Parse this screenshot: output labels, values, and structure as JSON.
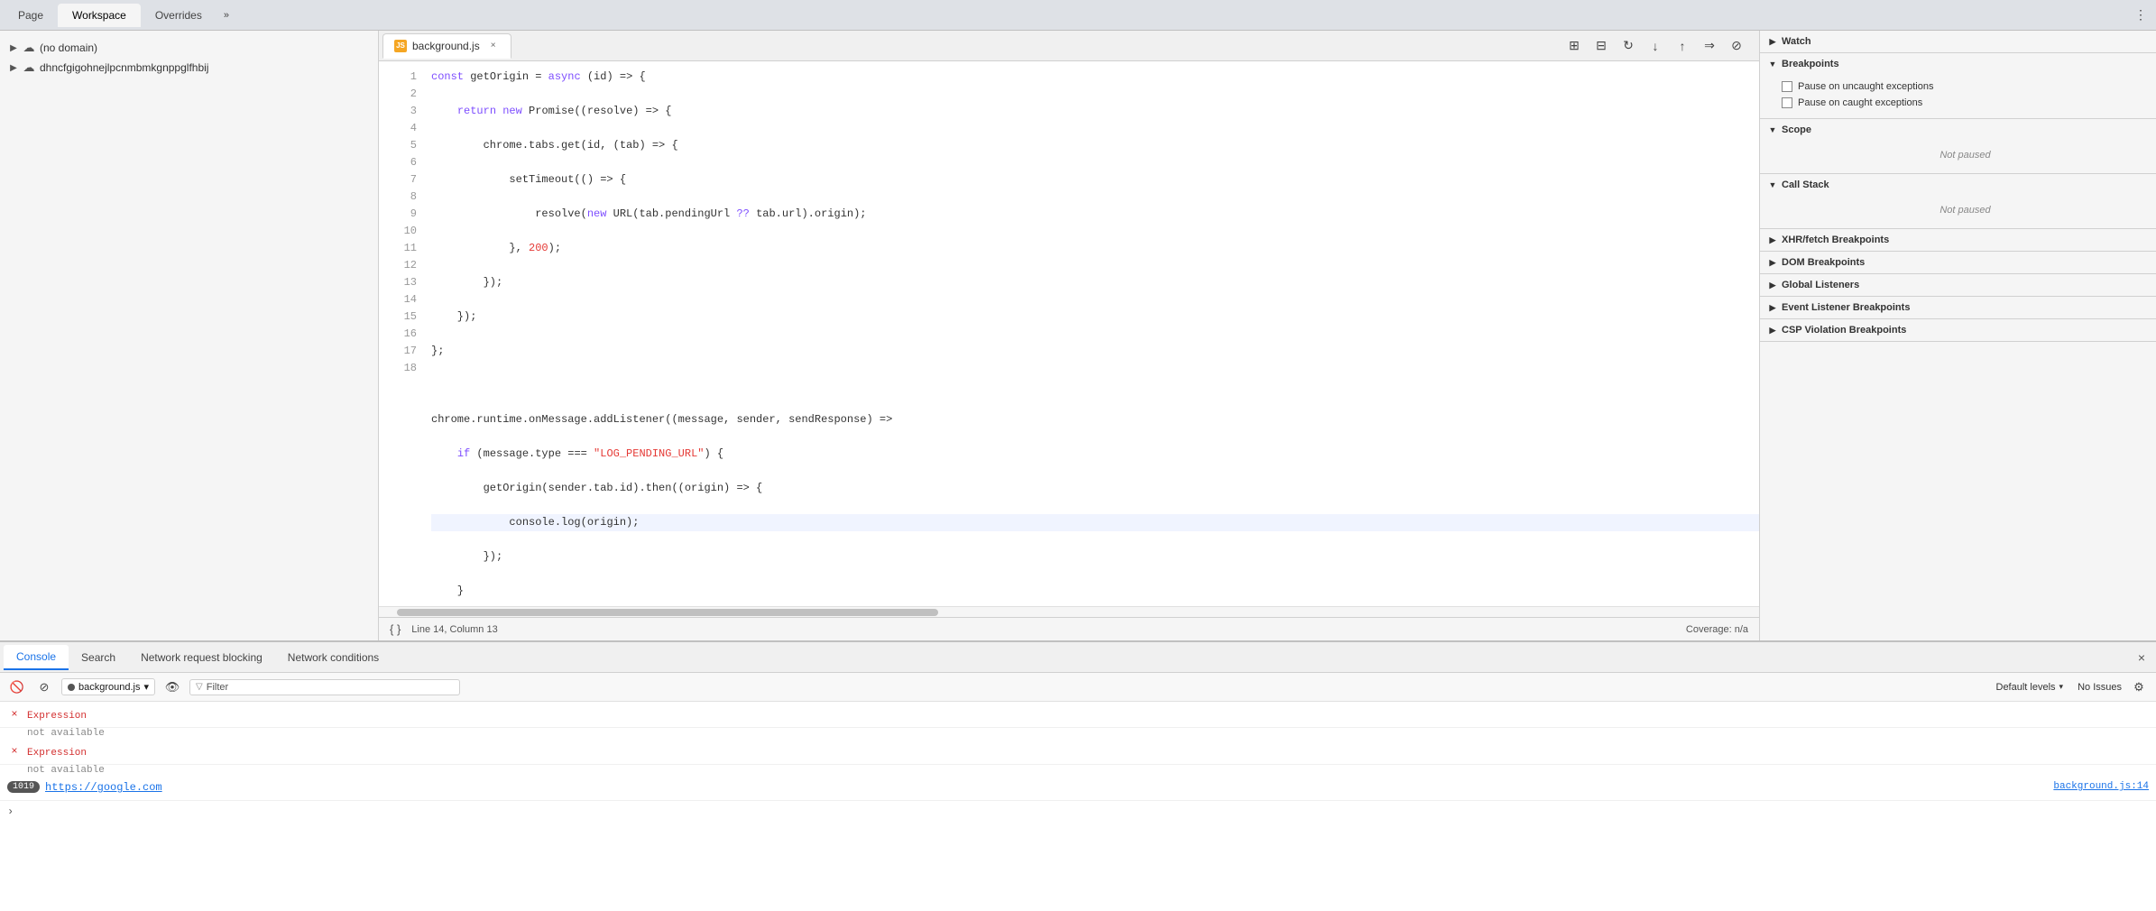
{
  "topTabs": {
    "items": [
      {
        "label": "Page",
        "active": false
      },
      {
        "label": "Workspace",
        "active": true
      },
      {
        "label": "Overrides",
        "active": false
      }
    ],
    "moreIcon": "»"
  },
  "fileTree": {
    "items": [
      {
        "label": "(no domain)",
        "level": 0,
        "expanded": false
      },
      {
        "label": "dhncfgigohnejlpcnmbmkgnppglfhbij",
        "level": 0,
        "expanded": false
      }
    ]
  },
  "fileTab": {
    "filename": "background.js",
    "closeIcon": "×"
  },
  "toolbarButtons": [
    {
      "name": "split-editor",
      "icon": "⊞"
    },
    {
      "name": "col-layout",
      "icon": "⊟"
    },
    {
      "name": "refresh",
      "icon": "↻"
    },
    {
      "name": "step-down",
      "icon": "↓"
    },
    {
      "name": "step-up",
      "icon": "↑"
    },
    {
      "name": "step-right",
      "icon": "⇒"
    },
    {
      "name": "no-breakpoints",
      "icon": "⊘"
    }
  ],
  "codeEditor": {
    "lines": [
      {
        "num": 1,
        "code": "const getOrigin = async (id) => {",
        "tokens": [
          {
            "type": "kw",
            "t": "const"
          },
          {
            "type": "plain",
            "t": " getOrigin = "
          },
          {
            "type": "kw",
            "t": "async"
          },
          {
            "type": "plain",
            "t": " (id) => {"
          }
        ]
      },
      {
        "num": 2,
        "code": "    return new Promise((resolve) => {",
        "tokens": [
          {
            "type": "plain",
            "t": "    "
          },
          {
            "type": "kw",
            "t": "return"
          },
          {
            "type": "plain",
            "t": " "
          },
          {
            "type": "kw",
            "t": "new"
          },
          {
            "type": "plain",
            "t": " Promise((resolve) => {"
          }
        ]
      },
      {
        "num": 3,
        "code": "        chrome.tabs.get(id, (tab) => {",
        "tokens": [
          {
            "type": "plain",
            "t": "        chrome.tabs.get(id, (tab) => {"
          }
        ]
      },
      {
        "num": 4,
        "code": "            setTimeout(() => {",
        "tokens": [
          {
            "type": "plain",
            "t": "            setTimeout(() => {"
          }
        ]
      },
      {
        "num": 5,
        "code": "                resolve(new URL(tab.pendingUrl ?? tab.url).origin);",
        "tokens": [
          {
            "type": "plain",
            "t": "                resolve("
          },
          {
            "type": "kw",
            "t": "new"
          },
          {
            "type": "plain",
            "t": " URL(tab.pendingUrl "
          },
          {
            "type": "kw",
            "t": "??"
          },
          {
            "type": "plain",
            "t": " tab.url).origin);"
          }
        ]
      },
      {
        "num": 6,
        "code": "            }, 200);",
        "tokens": [
          {
            "type": "plain",
            "t": "            }, "
          },
          {
            "type": "num",
            "t": "200"
          },
          {
            "type": "plain",
            "t": ");"
          }
        ]
      },
      {
        "num": 7,
        "code": "        });",
        "tokens": [
          {
            "type": "plain",
            "t": "        });"
          }
        ]
      },
      {
        "num": 8,
        "code": "    });",
        "tokens": [
          {
            "type": "plain",
            "t": "    });"
          }
        ]
      },
      {
        "num": 9,
        "code": "};",
        "tokens": [
          {
            "type": "plain",
            "t": "};"
          }
        ]
      },
      {
        "num": 10,
        "code": "",
        "tokens": []
      },
      {
        "num": 11,
        "code": "chrome.runtime.onMessage.addListener((message, sender, sendResponse) =>",
        "tokens": [
          {
            "type": "plain",
            "t": "chrome.runtime.onMessage.addListener((message, sender, sendResponse) =>"
          }
        ]
      },
      {
        "num": 12,
        "code": "    if (message.type === \"LOG_PENDING_URL\") {",
        "tokens": [
          {
            "type": "plain",
            "t": "    "
          },
          {
            "type": "kw",
            "t": "if"
          },
          {
            "type": "plain",
            "t": " (message.type === "
          },
          {
            "type": "str",
            "t": "\"LOG_PENDING_URL\""
          },
          {
            "type": "plain",
            "t": ") {"
          }
        ]
      },
      {
        "num": 13,
        "code": "        getOrigin(sender.tab.id).then((origin) => {",
        "tokens": [
          {
            "type": "plain",
            "t": "        getOrigin(sender.tab.id).then((origin) => {"
          }
        ]
      },
      {
        "num": 14,
        "code": "            console.log(origin);",
        "tokens": [
          {
            "type": "plain",
            "t": "            "
          },
          {
            "type": "plain",
            "t": "console.log(origin);"
          }
        ],
        "active": true
      },
      {
        "num": 15,
        "code": "        });",
        "tokens": [
          {
            "type": "plain",
            "t": "        });"
          }
        ]
      },
      {
        "num": 16,
        "code": "    }",
        "tokens": [
          {
            "type": "plain",
            "t": "    }"
          }
        ]
      },
      {
        "num": 17,
        "code": "});",
        "tokens": [
          {
            "type": "plain",
            "t": "});"
          }
        ]
      },
      {
        "num": 18,
        "code": "",
        "tokens": []
      }
    ]
  },
  "statusBar": {
    "left": "{ }",
    "lineCol": "Line 14, Column 13",
    "right": "Coverage: n/a"
  },
  "debugPanel": {
    "sections": [
      {
        "name": "watch",
        "label": "Watch",
        "expanded": false,
        "arrow": "▶"
      },
      {
        "name": "breakpoints",
        "label": "Breakpoints",
        "expanded": true,
        "arrow": "▼",
        "items": [
          {
            "type": "checkbox",
            "label": "Pause on uncaught exceptions"
          },
          {
            "type": "checkbox",
            "label": "Pause on caught exceptions"
          }
        ]
      },
      {
        "name": "scope",
        "label": "Scope",
        "expanded": true,
        "arrow": "▼",
        "notPaused": "Not paused"
      },
      {
        "name": "callstack",
        "label": "Call Stack",
        "expanded": true,
        "arrow": "▼",
        "notPaused": "Not paused"
      },
      {
        "name": "xhr",
        "label": "XHR/fetch Breakpoints",
        "expanded": false,
        "arrow": "▶"
      },
      {
        "name": "dom",
        "label": "DOM Breakpoints",
        "expanded": false,
        "arrow": "▶"
      },
      {
        "name": "global",
        "label": "Global Listeners",
        "expanded": false,
        "arrow": "▶"
      },
      {
        "name": "event",
        "label": "Event Listener Breakpoints",
        "expanded": false,
        "arrow": "▶"
      },
      {
        "name": "csp",
        "label": "CSP Violation Breakpoints",
        "expanded": false,
        "arrow": "▶"
      }
    ]
  },
  "bottomTabs": {
    "items": [
      {
        "label": "Console",
        "active": true
      },
      {
        "label": "Search",
        "active": false
      },
      {
        "label": "Network request blocking",
        "active": false
      },
      {
        "label": "Network conditions",
        "active": false
      }
    ],
    "closeIcon": "×"
  },
  "consoleToolbar": {
    "clearIcon": "🚫",
    "sourceLabel": "background.js",
    "filterPlaceholder": "Filter",
    "filterLabel": "Filter",
    "levelsLabel": "Default levels",
    "noIssues": "No Issues",
    "eyeIcon": "👁"
  },
  "consoleEntries": [
    {
      "type": "error",
      "icon": "×",
      "labelType": "text",
      "text": "Expression",
      "sub": "not available"
    },
    {
      "type": "error",
      "icon": "×",
      "labelType": "text",
      "text": "Expression",
      "sub": "not available"
    },
    {
      "type": "log",
      "badge": "1019",
      "url": "https://google.com",
      "sourceRef": "background.js:14"
    }
  ]
}
